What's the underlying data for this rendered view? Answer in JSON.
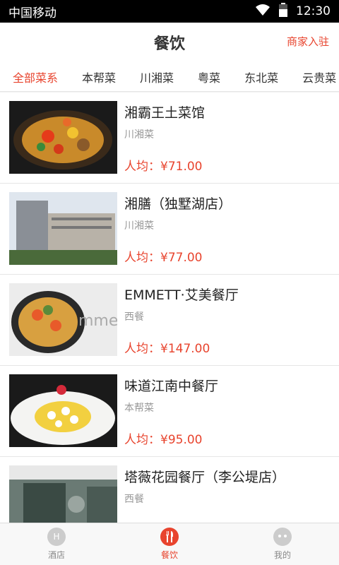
{
  "statusbar": {
    "carrier": "中国移动",
    "time": "12:30"
  },
  "header": {
    "title": "餐饮",
    "merchant_link": "商家入驻"
  },
  "tabs": [
    "全部菜系",
    "本帮菜",
    "川湘菜",
    "粤菜",
    "东北菜",
    "云贵菜"
  ],
  "restaurants": [
    {
      "name": "湘霸王土菜馆",
      "category": "川湘菜",
      "price": "人均：¥71.00"
    },
    {
      "name": "湘膳（独墅湖店）",
      "category": "川湘菜",
      "price": "人均：¥77.00"
    },
    {
      "name": "EMMETT·艾美餐厅",
      "category": "西餐",
      "price": "人均：¥147.00"
    },
    {
      "name": "味道江南中餐厅",
      "category": "本帮菜",
      "price": "人均：¥95.00"
    },
    {
      "name": "塔薇花园餐厅（李公堤店）",
      "category": "西餐",
      "price": ""
    }
  ],
  "thumb_watermark": "mmet",
  "bottomnav": [
    {
      "label": "酒店",
      "icon": "hotel-icon"
    },
    {
      "label": "餐饮",
      "icon": "dining-icon"
    },
    {
      "label": "我的",
      "icon": "profile-icon"
    }
  ]
}
